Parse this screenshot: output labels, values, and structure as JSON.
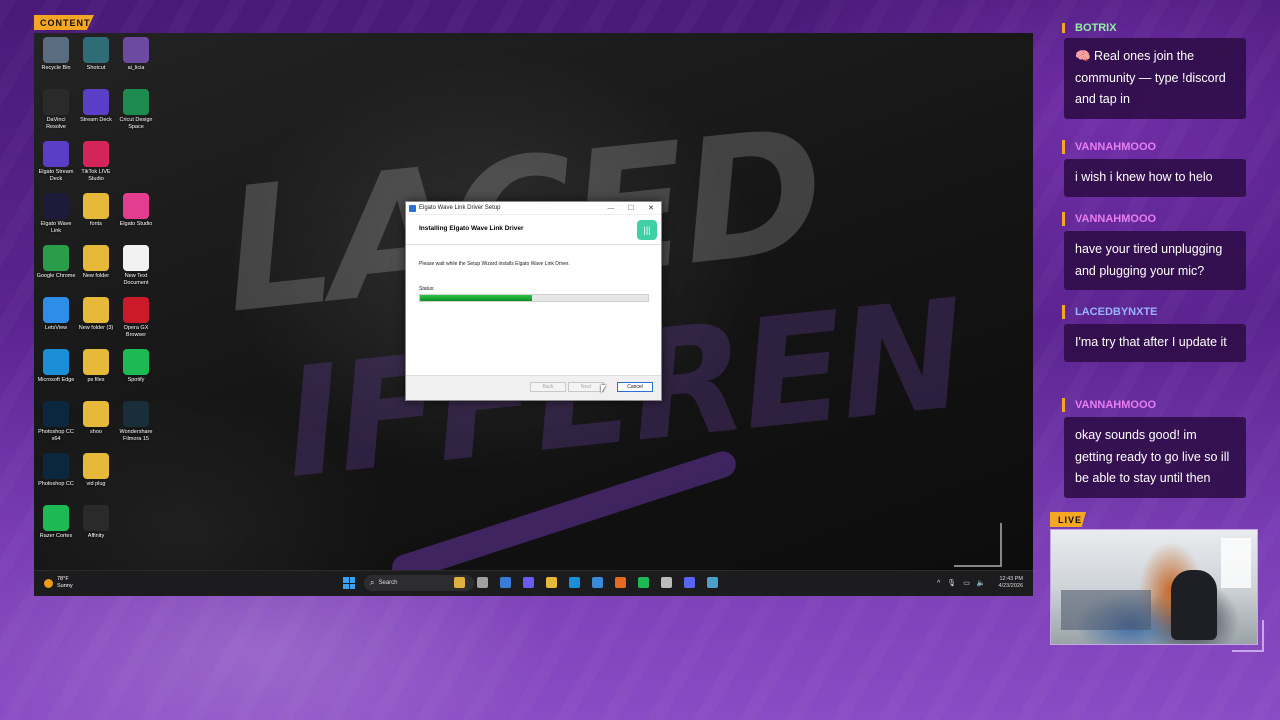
{
  "badges": {
    "content": "CONTENT",
    "live": "LIVE"
  },
  "wallpaper": {
    "text_top": "LACED",
    "text_bottom": "IFFEREN"
  },
  "desktop_icons": [
    {
      "label": "Recycle Bin",
      "icon": "recycle-bin-icon",
      "color": "#5a6d80"
    },
    {
      "label": "Shotcut",
      "icon": "shotcut-icon",
      "color": "#2f6d76"
    },
    {
      "label": "ai_licia",
      "icon": "ai-licia-icon",
      "color": "#6c4aa0"
    },
    {
      "label": "DaVinci Resolve",
      "icon": "davinci-resolve-icon",
      "color": "#2a2a2a"
    },
    {
      "label": "Stream Deck",
      "icon": "stream-deck-icon",
      "color": "#5a3ec8"
    },
    {
      "label": "Cricut Design Space",
      "icon": "cricut-icon",
      "color": "#1d8a4f"
    },
    {
      "label": "Elgato Stream Deck",
      "icon": "elgato-stream-deck-icon",
      "color": "#5a3ec8"
    },
    {
      "label": "TikTok LIVE Studio",
      "icon": "tiktok-icon",
      "color": "#d4255b"
    },
    {
      "label": "",
      "icon": "",
      "color": ""
    },
    {
      "label": "Elgato Wave Link",
      "icon": "wave-link-icon",
      "color": "#1c1c3a"
    },
    {
      "label": "fonts",
      "icon": "folder-icon",
      "color": "#e6b93a"
    },
    {
      "label": "Elgato Studio",
      "icon": "elgato-studio-icon",
      "color": "#e23d8e"
    },
    {
      "label": "Google Chrome",
      "icon": "chrome-icon",
      "color": "#2a9d4a"
    },
    {
      "label": "New folder",
      "icon": "folder-icon",
      "color": "#e6b93a"
    },
    {
      "label": "New Text Document",
      "icon": "text-document-icon",
      "color": "#f2f2f2"
    },
    {
      "label": "LetsView",
      "icon": "letsview-icon",
      "color": "#2c8ee6"
    },
    {
      "label": "New folder (3)",
      "icon": "folder-icon",
      "color": "#e6b93a"
    },
    {
      "label": "Opera GX Browser",
      "icon": "opera-gx-icon",
      "color": "#cc1a2a"
    },
    {
      "label": "Microsoft Edge",
      "icon": "edge-icon",
      "color": "#1a8fd8"
    },
    {
      "label": "ps files",
      "icon": "folder-icon",
      "color": "#e6b93a"
    },
    {
      "label": "Spotify",
      "icon": "spotify-icon",
      "color": "#1db954"
    },
    {
      "label": "Photoshop CC x64",
      "icon": "photoshop-icon",
      "color": "#0b2740"
    },
    {
      "label": "shoo",
      "icon": "folder-icon",
      "color": "#e6b93a"
    },
    {
      "label": "Wondershare Filmora 15",
      "icon": "filmora-icon",
      "color": "#1a2e3a"
    },
    {
      "label": "Photoshop CC",
      "icon": "photoshop-icon",
      "color": "#0b2740"
    },
    {
      "label": "vid plug",
      "icon": "folder-icon",
      "color": "#e6b93a"
    },
    {
      "label": "",
      "icon": "",
      "color": ""
    },
    {
      "label": "Razer Cortex",
      "icon": "razer-cortex-icon",
      "color": "#1db954"
    },
    {
      "label": "Affinity",
      "icon": "affinity-icon",
      "color": "#2a2a2a"
    }
  ],
  "installer": {
    "window_title": "Elgato Wave Link Driver Setup",
    "heading": "Installing Elgato Wave Link Driver",
    "description": "Please wait while the Setup Wizard installs Elgato Wave Link Driver.",
    "status_label": "Status:",
    "progress_percent": 49,
    "buttons": {
      "back": "Back",
      "next": "Next",
      "cancel": "Cancel"
    }
  },
  "taskbar": {
    "weather_temp": "78°F",
    "weather_desc": "Sunny",
    "search_placeholder": "Search",
    "time": "12:43 PM",
    "date": "4/23/2026",
    "pinned_apps": [
      {
        "icon": "widgets-icon",
        "color": "#e0b040"
      },
      {
        "icon": "task-view-icon",
        "color": "#a0a0a0"
      },
      {
        "icon": "stream-deck-icon",
        "color": "#3a7ad8"
      },
      {
        "icon": "copilot-icon",
        "color": "#6a5cf0"
      },
      {
        "icon": "file-explorer-icon",
        "color": "#e6b93a"
      },
      {
        "icon": "edge-icon",
        "color": "#1a8fd8"
      },
      {
        "icon": "store-icon",
        "color": "#3a8ad8"
      },
      {
        "icon": "firefox-icon",
        "color": "#e56a1f"
      },
      {
        "icon": "spotify-icon",
        "color": "#1db954"
      },
      {
        "icon": "settings-icon",
        "color": "#bbbbbb"
      },
      {
        "icon": "discord-icon",
        "color": "#5865f2"
      },
      {
        "icon": "installer-icon",
        "color": "#4aa0c8"
      }
    ]
  },
  "chat": [
    {
      "user": "BOTRIX",
      "user_class": "u-botrix",
      "message": "🧠 Real ones join the community — type !discord and tap in"
    },
    {
      "user": "VANNAHMOOO",
      "user_class": "u-vannah",
      "message": "i wish i knew how to helo"
    },
    {
      "user": "VANNAHMOOO",
      "user_class": "u-vannah",
      "message": "have your tired unplugging and plugging your mic?"
    },
    {
      "user": "LACEDBYNXTE",
      "user_class": "u-laced",
      "message": "I'ma try that after I update it"
    },
    {
      "user": "VANNAHMOOO",
      "user_class": "u-vannah",
      "message": "okay sounds good! im getting ready to go live so ill be able to stay until then"
    }
  ]
}
